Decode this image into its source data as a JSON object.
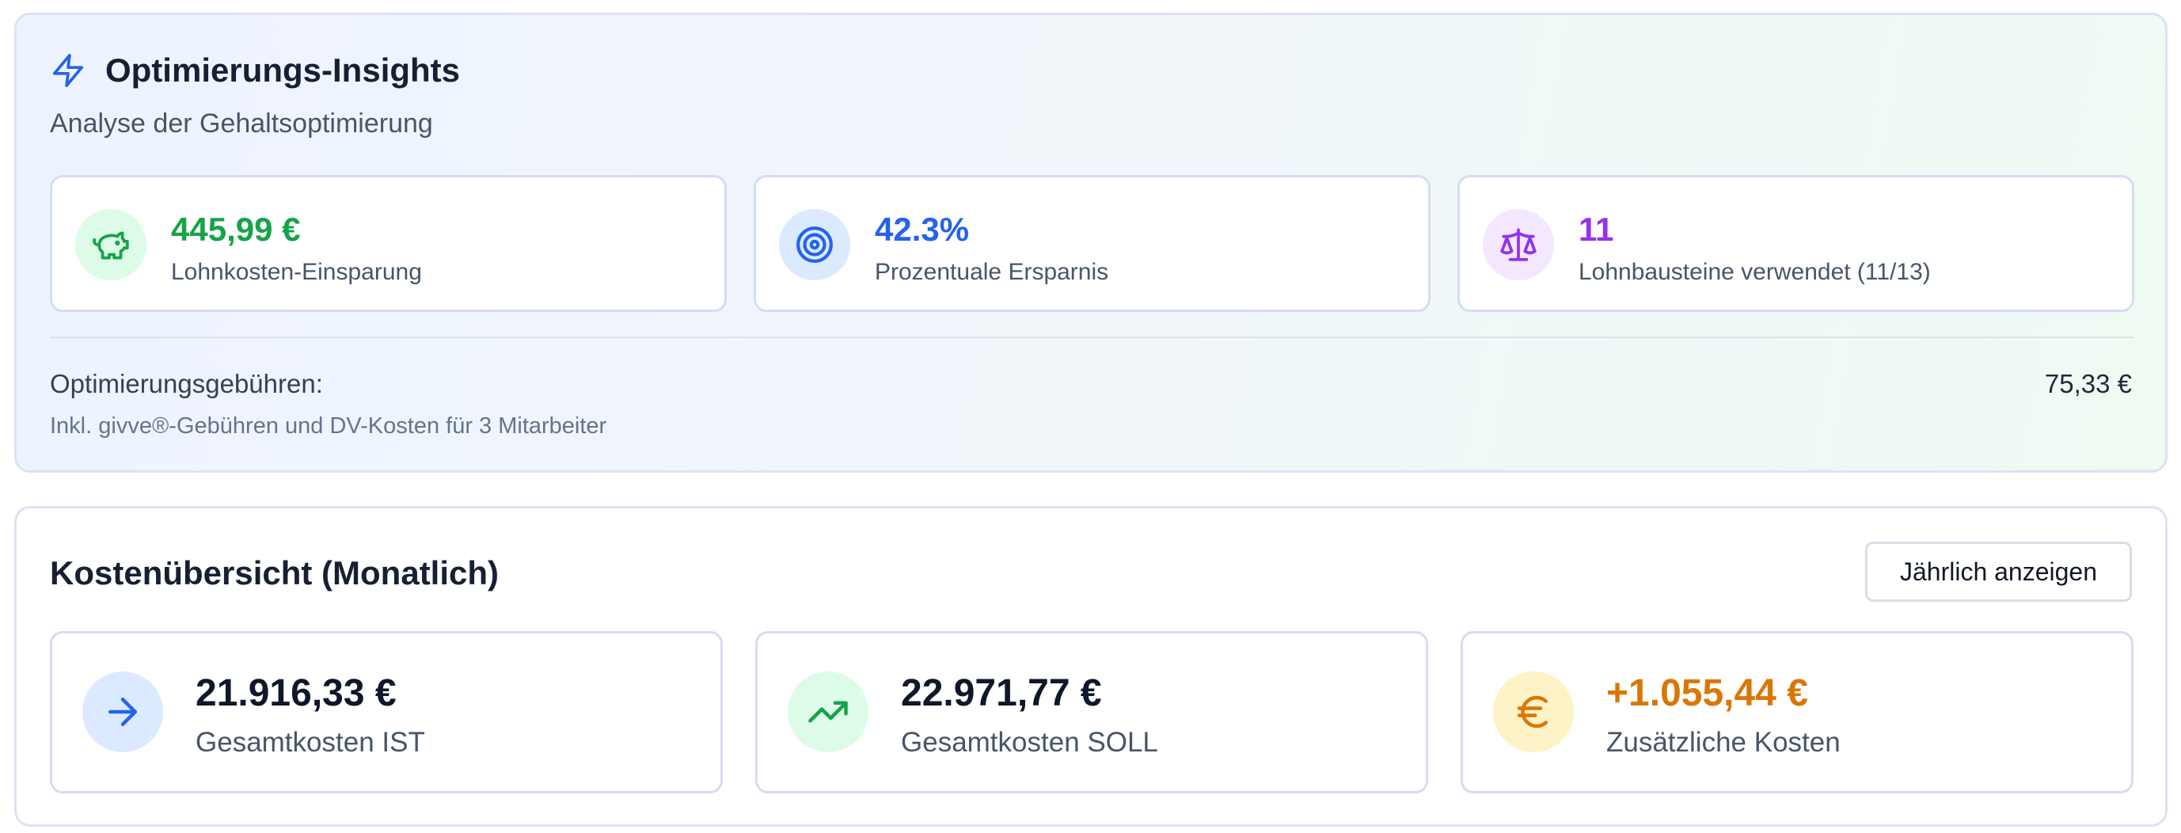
{
  "insights": {
    "title": "Optimierungs-Insights",
    "subtitle": "Analyse der Gehaltsoptimierung",
    "icon": "lightning-bolt-icon",
    "stats": [
      {
        "value": "445,99 €",
        "label": "Lohnkosten-Einsparung",
        "icon": "piggy-bank-icon",
        "color": "#16a34a",
        "icon_bg": "#dcfce7"
      },
      {
        "value": "42.3%",
        "label": "Prozentuale Ersparnis",
        "icon": "target-icon",
        "color": "#2563eb",
        "icon_bg": "#dbeafe"
      },
      {
        "value": "11",
        "label": "Lohnbausteine verwendet (11/13)",
        "icon": "scale-icon",
        "color": "#9333ea",
        "icon_bg": "#f3e8ff"
      }
    ],
    "fees": {
      "label": "Optimierungsgebühren:",
      "value": "75,33 €",
      "note": "Inkl. givve®-Gebühren und DV-Kosten für 3 Mitarbeiter"
    }
  },
  "costs": {
    "title": "Kostenübersicht (Monatlich)",
    "toggle_label": "Jährlich anzeigen",
    "cards": [
      {
        "value": "21.916,33 €",
        "label": "Gesamtkosten IST",
        "icon": "arrow-right-icon",
        "color": "#0f172a",
        "icon_color": "#2563eb",
        "icon_bg": "#dbeafe"
      },
      {
        "value": "22.971,77 €",
        "label": "Gesamtkosten SOLL",
        "icon": "trending-up-icon",
        "color": "#0f172a",
        "icon_color": "#16a34a",
        "icon_bg": "#dcfce7"
      },
      {
        "value": "+1.055,44 €",
        "label": "Zusätzliche Kosten",
        "icon": "euro-icon",
        "color": "#d97706",
        "icon_color": "#d97706",
        "icon_bg": "#fef3c7"
      }
    ]
  },
  "colors": {
    "accent_blue": "#2563eb",
    "success_green": "#16a34a",
    "purple": "#9333ea",
    "warning_orange": "#d97706"
  }
}
